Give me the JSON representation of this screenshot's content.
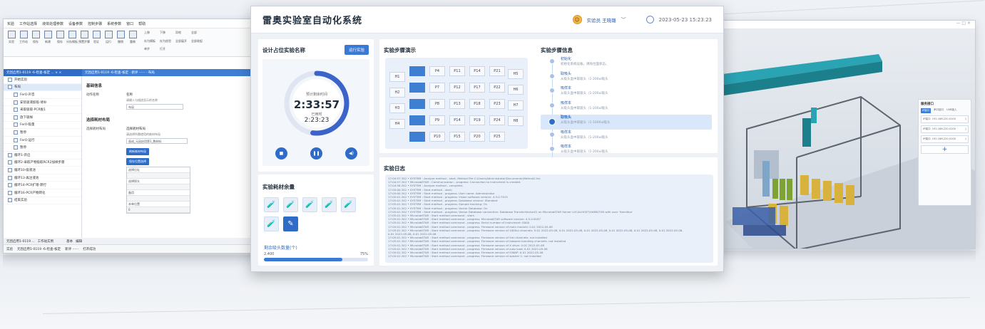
{
  "main": {
    "title": "雷奥实验室自动化系统",
    "user": "实验员 王晓璐",
    "datetime": "2023-05-23 15:23:23",
    "design": {
      "title": "设计占位实验名称",
      "run_button": "运行实验",
      "timer_label": "预计剩余时间",
      "time_remaining": "2:33:57",
      "elapsed_label": "已用时",
      "time_elapsed": "2:23:23",
      "progress": 0.52
    },
    "consumables": {
      "title": "实验耗材余量",
      "remaining_label": "剩余吸头数量(个)",
      "remaining_value": "2,400",
      "percent": "75%",
      "fill": 0.75
    },
    "demo": {
      "title": "实验步骤演示",
      "left_labels": [
        "H1",
        "H2",
        "H3",
        "H4"
      ],
      "right_labels": [
        "H5",
        "H6",
        "H7",
        "H8"
      ],
      "wells": [
        [
          "P4",
          "P11",
          "P14",
          "P21"
        ],
        [
          "P7",
          "P12",
          "P17",
          "P22"
        ],
        [
          "P8",
          "P13",
          "P18",
          "P23"
        ],
        [
          "P9",
          "P14",
          "P19",
          "P24"
        ],
        [
          "P10",
          "P15",
          "P20",
          "P25"
        ]
      ]
    },
    "steps": {
      "title": "实验步骤信息",
      "items": [
        {
          "title": "初始化",
          "desc": "初始化系统设备，清除台面状态。"
        },
        {
          "title": "取吸头",
          "desc": "从吸头盒中取吸头（1-200ul吸头"
        },
        {
          "title": "吸样本",
          "desc": "从吸头盒中取吸头（1-200ul吸头"
        },
        {
          "title": "吸样本",
          "desc": "从吸头盒中取吸头（1-200ul吸头"
        },
        {
          "title": "取吸头",
          "desc": "从吸头盒中取吸头（1-1000ul吸头"
        },
        {
          "title": "吸样本",
          "desc": "从吸头盒中取吸头（1-200ul吸头"
        },
        {
          "title": "吸样本",
          "desc": "从吸头盒中取吸头（1-200ul吸头"
        },
        {
          "title": "吸样本",
          "desc": "从吸头盒中取吸头（1-200ul吸头"
        }
      ],
      "active_index": 4
    },
    "log": {
      "title": "实验日志",
      "lines": [
        "17:04:57.342 • SYSTEM : Analyze method - start, Method File C:\\Users\\Administrator\\Documents\\Method2.hsl",
        "17:04:57.342 • MicrolabSTAR : Communication - progress: Connection to instrument is created.",
        "17:04:58.342 • SYSTEM : Analyze method - complete;",
        "17:05:00.342 • SYSTEM : Start method - start;",
        "17:05:00.342 • SYSTEM : Start method - progress: User name: Administrator",
        "17:05:01.342 • SYSTEM : Start method - progress: Vision software version: 4.5.0.7915",
        "17:05:01.342 • SYSTEM : Start method - progress: Database version: Standard",
        "17:05:01.342 • SYSTEM : Start method - progress: Sample tracking: On",
        "17:05:01.342 • SYSTEM : Start method - progress: Vector Database: On",
        "17:05:01.342 • SYSTEM : Start method - progress: Vector Database connection: Database TransferVector01 on MicrolabSTAR Server LOCALHOST\\HAMILTON with user 'Hamilton'",
        "17:05:01.342 • MicrolabSTAR : Start method command - start;",
        "17:05:01.342 • MicrolabSTAR : Start method command - progress: MicrolabSTAR software version: 4.5.0.8187",
        "17:05:01.342 • MicrolabSTAR : Start method command - progress: Serial number of instrument: 0000",
        "17:05:01.342 • MicrolabSTAR : Start method command - progress: Firmware version of main module: 0.01 2022-05-08",
        "17:05:01.342 • MicrolabSTAR : Start method command - progress: Firmware version of 1000ul channels: 0.01 2022-05-08, 0.01 2022-05-08, 0.01 2022-05-08, 0.01 2022-05-08, 0.01 2022-05-08, 0.01 2022-05-08,",
        "0.01 2022-05-08, 0.01 2022-05-08",
        "17:05:01.342 • MicrolabSTAR : Start method command - progress: Firmware version of 5ml channels: not installed",
        "17:05:01.342 • MicrolabSTAR : Start method command - progress: Firmware version of labware-handling channels: not installed",
        "17:05:01.342 • MicrolabSTAR : Start method command - progress: Firmware version of X drive: 0.01 2022-05-08",
        "17:05:01.342 • MicrolabSTAR : Start method command - progress: Firmware version of auto load: 0.01 2022-05-08",
        "17:05:01.342 • MicrolabSTAR : Start method command - progress: Firmware version of iSWAP: 0.01 2022-05-08",
        "17:05:01.342 • MicrolabSTAR : Start method command - progress: Firmware version of washer 1: not installed"
      ]
    }
  },
  "left": {
    "menu": [
      "实验",
      "工作站选择",
      "液体处理参数",
      "设备参数",
      "控制步骤",
      "系统参数",
      "窗口",
      "帮助"
    ],
    "ribbon": [
      "实验",
      "工作站",
      "保存",
      "新建",
      "保存",
      "另存模板",
      "预置步骤",
      "验证",
      "运行",
      "撤销",
      "重做"
    ],
    "ribbon_right": [
      "上移",
      "下移",
      "异地",
      "全部",
      "存为模板",
      "存为经验",
      "全部展开",
      "全部收起",
      "单步",
      "打开"
    ],
    "groups": [
      "实验",
      "编辑",
      "步骤"
    ],
    "tab_tree": "元因启用1-0119 -6-检查-核定 ... × ×",
    "tab_main": "元因启用1-0119 -6-检查-核定 · 新评 ······ · 布局",
    "tree": [
      {
        "label": "开始实验",
        "ind": false,
        "sel": false
      },
      {
        "label": "布局",
        "ind": false,
        "sel": true
      },
      {
        "label": "Fer0-声音",
        "ind": true,
        "sel": false
      },
      {
        "label": "安装吸液胶吸-修补",
        "ind": true,
        "sel": false
      },
      {
        "label": "采取吸取-PCR板1",
        "ind": true,
        "sel": false
      },
      {
        "label": "放下吸样",
        "ind": true,
        "sel": false
      },
      {
        "label": "Fer0-吸量",
        "ind": true,
        "sel": false
      },
      {
        "label": "暂停",
        "ind": true,
        "sel": false
      },
      {
        "label": "Fer0-运行",
        "ind": true,
        "sel": false
      },
      {
        "label": "暂停",
        "ind": true,
        "sel": false
      },
      {
        "label": "循环1-开启",
        "ind": false,
        "sel": false
      },
      {
        "label": "循环2-采取产物吸取RCR2加样步骤",
        "ind": false,
        "sel": false
      },
      {
        "label": "循环10-吸液池",
        "ind": false,
        "sel": false
      },
      {
        "label": "循环13-再注液池",
        "ind": false,
        "sel": false
      },
      {
        "label": "循环14-PCR扩增-转行",
        "ind": false,
        "sel": false
      },
      {
        "label": "循环16-PCR产物转化",
        "ind": false,
        "sel": false
      },
      {
        "label": "结束实验",
        "ind": false,
        "sel": false
      }
    ],
    "props": {
      "basic": "基础信息",
      "action_label": "动作名称",
      "name_caption": "名称",
      "name_hint": "请输入与描述显示的名称",
      "name_value": "布局",
      "consumable_title": "选择耗材布局",
      "layout_label": "选择耗材布局",
      "layout_caption": "选择耗材布局",
      "layout_hint": "请选择所需使用的耗材布局",
      "layout_value": "画成_元因启用第1_胞材料",
      "btn1": "刷新耗材布局",
      "btn2": "保存位置选择",
      "table": [
        "选择位址",
        "",
        "选择探头",
        "",
        "备用",
        "",
        "本单位置",
        "0"
      ]
    },
    "bottom_tabs": [
      "元因启用1-0119 ...",
      "工作站实例"
    ],
    "bottom_tabs2": [
      "基本",
      "编辑"
    ],
    "status": [
      "实验",
      "元因启用1-0119 -6-检查-核定",
      "新评 ······",
      "打开成功"
    ]
  },
  "right": {
    "window_controls": "— □ ×",
    "card_title": "服务接口",
    "tabs": [
      "IP接口",
      "串口接口",
      "USB接入"
    ],
    "rows": [
      "IP端口: 192.168.220.0100",
      "IP端口: 192.168.220.0100",
      "IP端口: 192.168.220.0100"
    ],
    "add": "+"
  }
}
